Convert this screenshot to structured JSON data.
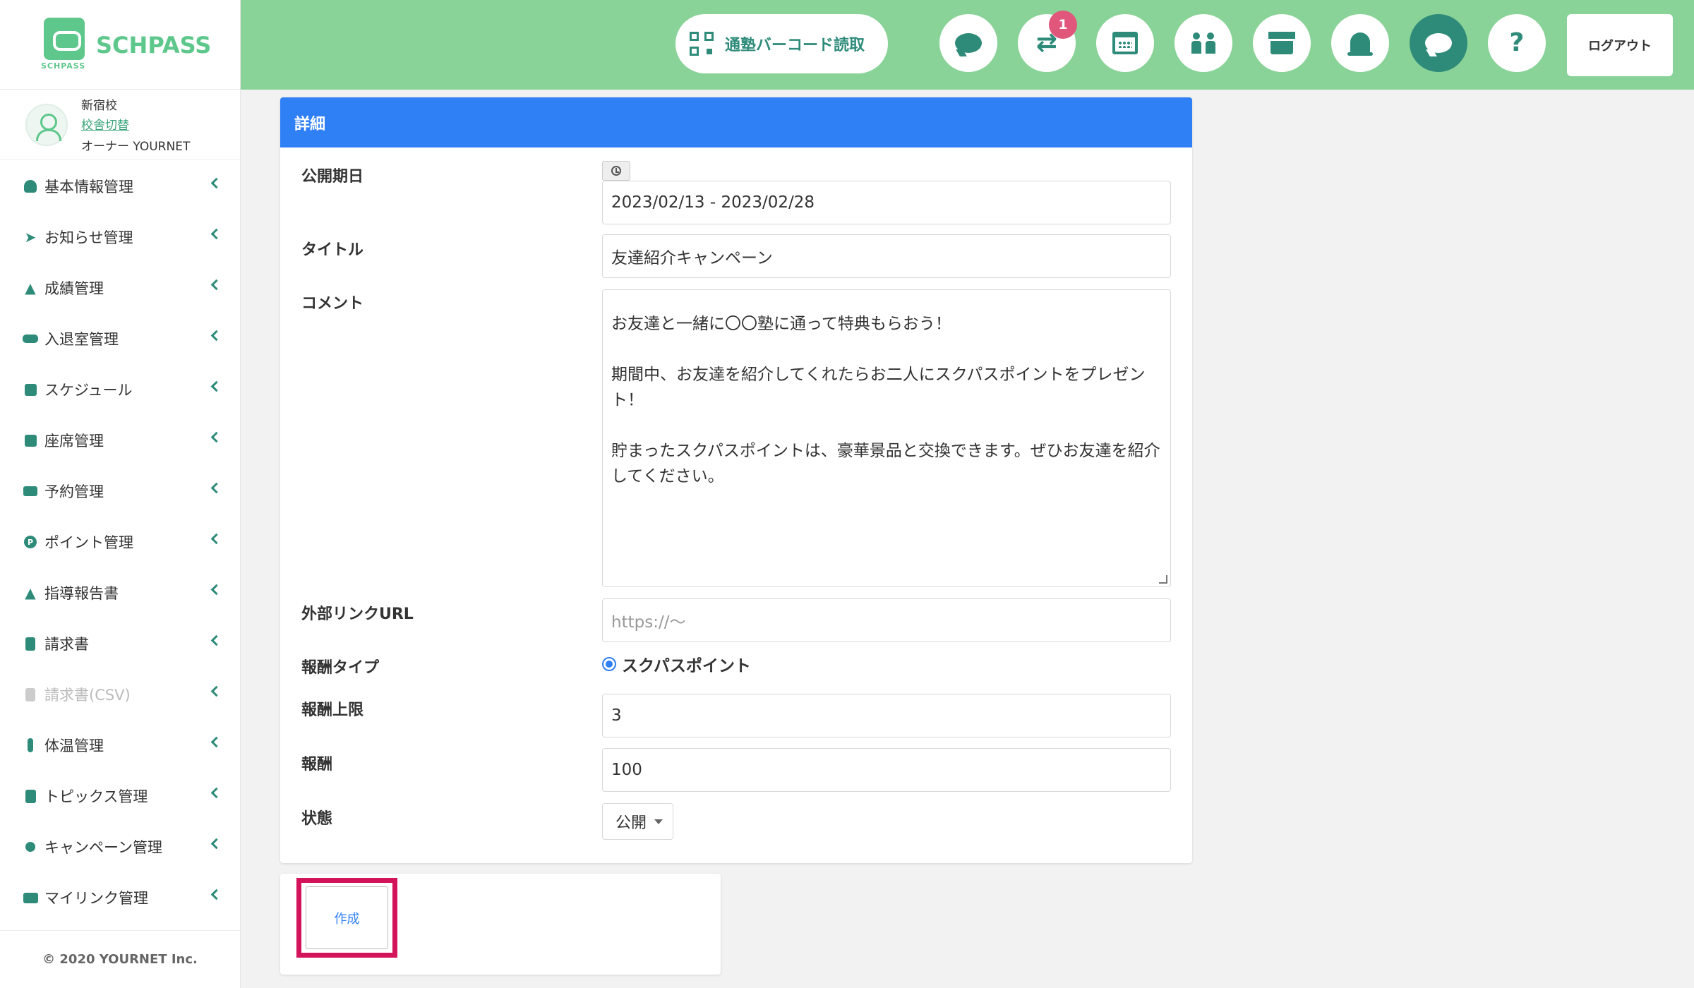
{
  "app": {
    "logo_text": "SCHPASS",
    "logo_sub": "SCHPASS"
  },
  "school": {
    "name": "新宿校",
    "switch_link": "校舎切替",
    "owner": "オーナー YOURNET"
  },
  "sidebar": {
    "items": [
      {
        "label": "基本情報管理",
        "icon": "person-icon"
      },
      {
        "label": "お知らせ管理",
        "icon": "paper-plane-icon"
      },
      {
        "label": "成績管理",
        "icon": "graduation-cap-icon"
      },
      {
        "label": "入退室管理",
        "icon": "car-icon"
      },
      {
        "label": "スケジュール",
        "icon": "calendar-check-icon"
      },
      {
        "label": "座席管理",
        "icon": "calendar-grid-icon"
      },
      {
        "label": "予約管理",
        "icon": "chalkboard-icon"
      },
      {
        "label": "ポイント管理",
        "icon": "p-coin-icon"
      },
      {
        "label": "指導報告書",
        "icon": "graduation-cap-icon"
      },
      {
        "label": "請求書",
        "icon": "invoice-icon"
      },
      {
        "label": "請求書(CSV)",
        "icon": "invoice-icon",
        "disabled": true
      },
      {
        "label": "体温管理",
        "icon": "thermometer-icon"
      },
      {
        "label": "トピックス管理",
        "icon": "book-icon"
      },
      {
        "label": "キャンペーン管理",
        "icon": "award-icon"
      },
      {
        "label": "マイリンク管理",
        "icon": "id-card-icon"
      }
    ]
  },
  "footer": {
    "copyright": "© 2020 YOURNET Inc."
  },
  "header": {
    "barcode_label": "通塾バーコード読取",
    "badge_count": "1",
    "logout_label": "ログアウト",
    "help_glyph": "?"
  },
  "card": {
    "title": "詳細"
  },
  "form": {
    "period_label": "公開期日",
    "period_value": "2023/02/13 - 2023/02/28",
    "title_label": "タイトル",
    "title_value": "友達紹介キャンペーン",
    "comment_label": "コメント",
    "comment_value": "お友達と一緒に〇〇塾に通って特典もらおう！\n\n期間中、お友達を紹介してくれたらお二人にスクパスポイントをプレゼント！\n\n貯まったスクパスポイントは、豪華景品と交換できます。ぜひお友達を紹介してください。",
    "url_label": "外部リンクURL",
    "url_placeholder": "https://〜",
    "reward_type_label": "報酬タイプ",
    "reward_type_option": "スクパスポイント",
    "reward_limit_label": "報酬上限",
    "reward_limit_value": "3",
    "reward_label": "報酬",
    "reward_value": "100",
    "status_label": "状態",
    "status_value": "公開"
  },
  "actions": {
    "create_label": "作成"
  },
  "colors": {
    "header_bg": "#8ad398",
    "accent": "#2e8b7a",
    "card_head": "#2f7ff5",
    "highlight": "#d4145a"
  }
}
